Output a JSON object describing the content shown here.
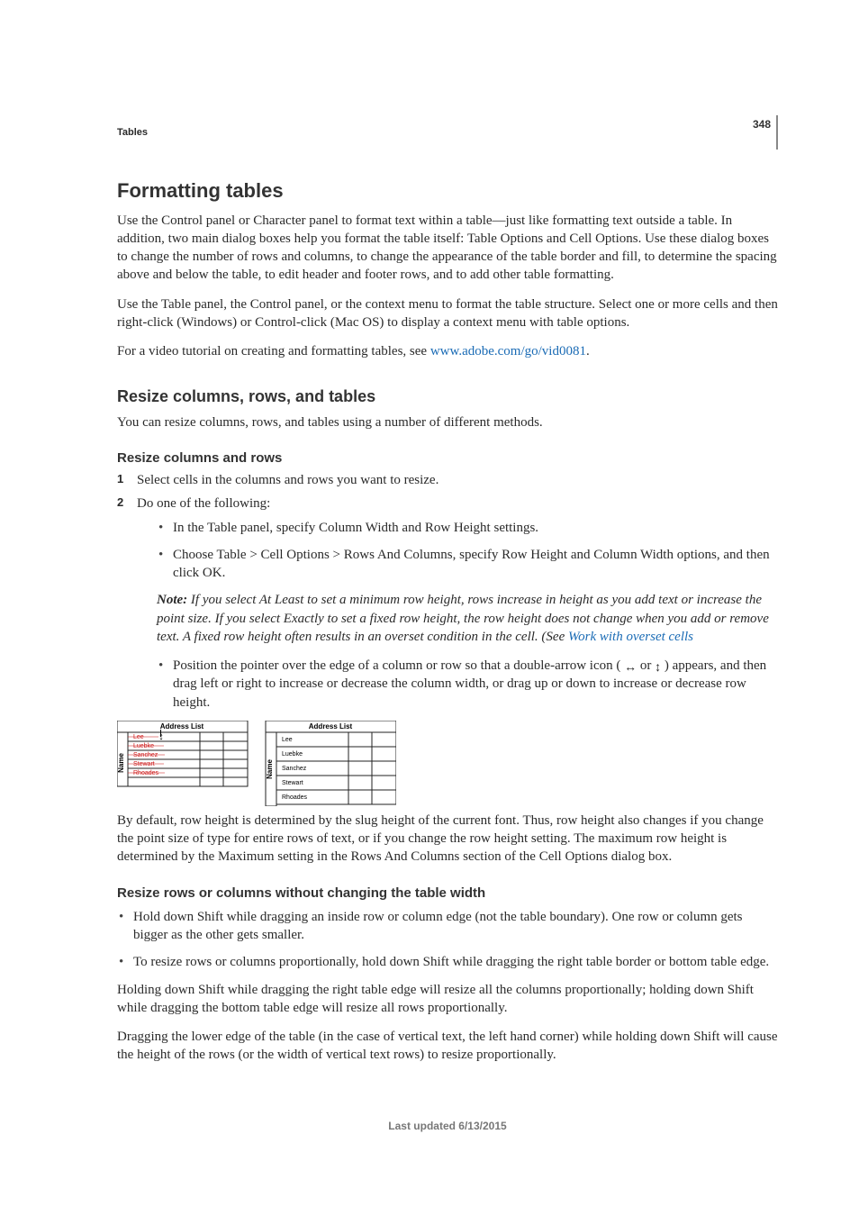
{
  "page_number": "348",
  "section_small": "Tables",
  "h1": "Formatting tables",
  "intro_p1": "Use the Control panel or Character panel to format text within a table—just like formatting text outside a table. In addition, two main dialog boxes help you format the table itself: Table Options and Cell Options. Use these dialog boxes to change the number of rows and columns, to change the appearance of the table border and fill, to determine the spacing above and below the table, to edit header and footer rows, and to add other table formatting.",
  "intro_p2": "Use the Table panel, the Control panel, or the context menu to format the table structure. Select one or more cells and then right-click (Windows) or Control-click (Mac OS) to display a context menu with table options.",
  "intro_p3_pre": "For a video tutorial on creating and formatting tables, see ",
  "intro_p3_link": "www.adobe.com/go/vid0081",
  "intro_p3_post": ".",
  "h2": "Resize columns, rows, and tables",
  "h2_p": "You can resize columns, rows, and tables using a number of different methods.",
  "h3a": "Resize columns and rows",
  "step1_num": "1",
  "step1": "Select cells in the columns and rows you want to resize.",
  "step2_num": "2",
  "step2": "Do one of the following:",
  "b1": "In the Table panel, specify Column Width and Row Height settings.",
  "b2": "Choose Table > Cell Options > Rows And Columns, specify Row Height and Column Width options, and then click OK.",
  "note_label": "Note: ",
  "note_body_pre": "If you select At Least to set a minimum row height, rows increase in height as you add text or increase the point size. If you select Exactly to set a fixed row height, the row height does not change when you add or remove text. A fixed row height often results in an overset condition in the cell. (See ",
  "note_link": "Work with overset cells",
  "b3_pre": "Position the pointer over the edge of a column or row so that a double-arrow icon ( ",
  "b3_mid": " or ",
  "b3_post": " ) appears, and then drag left or right to increase or decrease the column width, or drag up or down to increase or decrease row height.",
  "figure": {
    "title_left": "Address List",
    "title_right": "Address List",
    "side_label": "Name",
    "rows": [
      "Lee",
      "Luebke",
      "Sanchez",
      "Stewart",
      "Rhoades"
    ]
  },
  "after_fig": "By default, row height is determined by the slug height of the current font. Thus, row height also changes if you change the point size of type for entire rows of text, or if you change the row height setting. The maximum row height is determined by the Maximum setting in the Rows And Columns section of the Cell Options dialog box.",
  "h3b": "Resize rows or columns without changing the table width",
  "c1": "Hold down Shift while dragging an inside row or column edge (not the table boundary). One row or column gets bigger as the other gets smaller.",
  "c2": "To resize rows or columns proportionally, hold down Shift while dragging the right table border or bottom table edge.",
  "tail_p1": "Holding down Shift while dragging the right table edge will resize all the columns proportionally; holding down Shift while dragging the bottom table edge will resize all rows proportionally.",
  "tail_p2": "Dragging the lower edge of the table (in the case of vertical text, the left hand corner) while holding down Shift will cause the height of the rows (or the width of vertical text rows) to resize proportionally.",
  "footer": "Last updated 6/13/2015"
}
